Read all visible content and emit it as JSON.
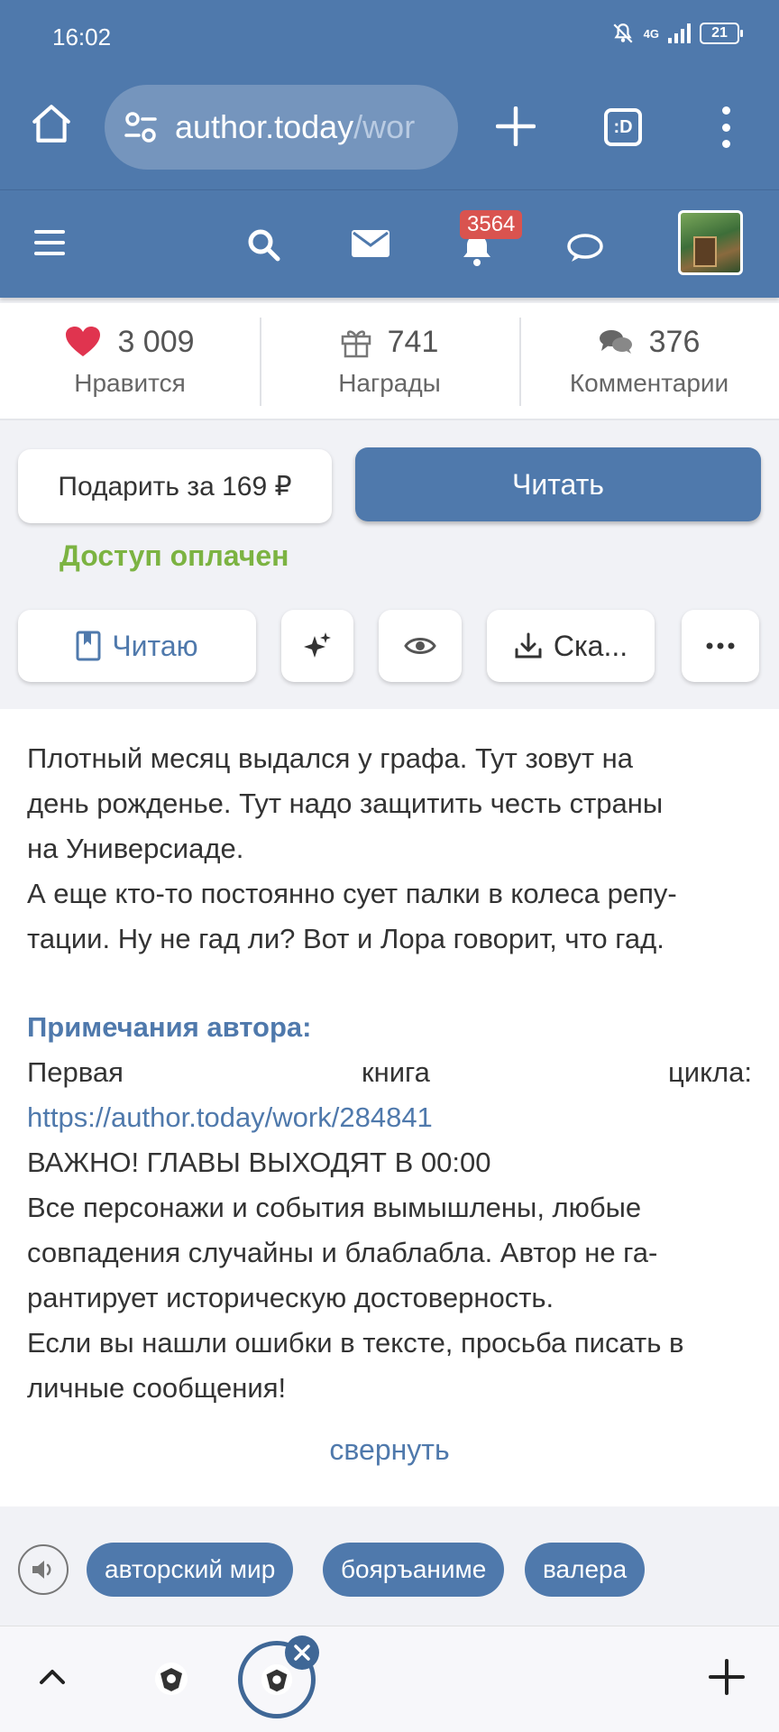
{
  "status_bar": {
    "time": "16:02",
    "network": "4G",
    "battery": "21"
  },
  "browser": {
    "url_host": "author.today",
    "url_path": "/wor",
    "tabs_label": ":D"
  },
  "site_header": {
    "notifications_count": "3564"
  },
  "stats": [
    {
      "value": "3 009",
      "label": "Нравится",
      "icon": "heart-icon"
    },
    {
      "value": "741",
      "label": "Награды",
      "icon": "gift-icon"
    },
    {
      "value": "376",
      "label": "Комментарии",
      "icon": "comments-icon"
    }
  ],
  "actions": {
    "gift_label": "Подарить за 169 ₽",
    "read_label": "Читать",
    "access_status": "Доступ оплачен",
    "reading_label": "Читаю",
    "download_label": "Ска..."
  },
  "description": {
    "para1_lines": [
      "Плотный месяц выдался у графа. Тут зовут на",
      "день рожденье. Тут надо защитить честь страны",
      "на Универсиаде."
    ],
    "para2_lines": [
      "А еще кто-то постоянно сует палки в колеса репу-",
      "тации. Ну не гад ли? Вот и Лора говорит, что гад."
    ],
    "notes_title": "Примечания автора:",
    "first_book_words": [
      "Первая",
      "книга",
      "цикла:"
    ],
    "first_book_link": "https://author.today/work/284841",
    "important": "ВАЖНО! ГЛАВЫ ВЫХОДЯТ В 00:00",
    "disclaimer_lines": [
      "Все персонажи и события вымышлены, любые",
      "совпадения случайны и блаблабла. Автор не га-",
      "рантирует историческую достоверность."
    ],
    "errors_lines": [
      "Если вы нашли ошибки в тексте, просьба писать в",
      "личные сообщения!"
    ],
    "collapse_label": "свернуть"
  },
  "tags": [
    "авторский мир",
    "бояръаниме",
    "валера"
  ],
  "colors": {
    "brand": "#4f79ac",
    "accent_green": "#7cb342",
    "badge_red": "#d9534f",
    "heart": "#e0344f"
  }
}
